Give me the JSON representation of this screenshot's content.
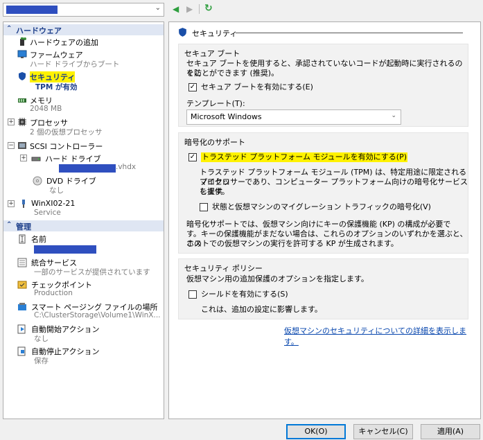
{
  "vm_selector": {
    "value": "",
    "chevron": "⌄"
  },
  "toolbar": {
    "back": "◀",
    "forward": "▶",
    "refresh": "↻"
  },
  "tree": {
    "hardware_header": "ハードウェア",
    "add_hardware": "ハードウェアの追加",
    "firmware": {
      "name": "ファームウェア",
      "sub": "ハード ドライブからブート"
    },
    "security": {
      "name": "セキュリティ",
      "sub": "TPM が有効"
    },
    "memory": {
      "name": "メモリ",
      "sub": "2048 MB"
    },
    "processor": {
      "name": "プロセッサ",
      "sub": "2 個の仮想プロセッサ"
    },
    "scsi": {
      "name": "SCSI コントローラー"
    },
    "hard_drive": {
      "name": "ハード ドライブ",
      "sub_suffix": ".vhdx"
    },
    "dvd": {
      "name": "DVD ドライブ",
      "sub": "なし"
    },
    "nic": {
      "name": "WinXI02-21",
      "sub": "Service"
    },
    "management_header": "管理",
    "name_item": {
      "name": "名前"
    },
    "integration": {
      "name": "統合サービス",
      "sub": "一部のサービスが提供されています"
    },
    "checkpoint": {
      "name": "チェックポイント",
      "sub": "Production"
    },
    "paging": {
      "name": "スマート ページング ファイルの場所",
      "sub": "C:\\ClusterStorage\\Volume1\\WinX..."
    },
    "autostart": {
      "name": "自動開始アクション",
      "sub": "なし"
    },
    "autostop": {
      "name": "自動停止アクション",
      "sub": "保存"
    }
  },
  "security_pane": {
    "title": "セキュリティ",
    "secure_boot": {
      "title": "セキュア ブート",
      "desc1": "セキュア ブートを使用すると、承認されていないコードが起動時に実行されるのを防",
      "desc2": "ぐことができます (推奨)。",
      "checkbox": "セキュア ブートを有効にする(E)",
      "checked": true,
      "template_label": "テンプレート(T):",
      "template_value": "Microsoft Windows"
    },
    "encryption": {
      "title": "暗号化のサポート",
      "tpm_checkbox": "トラステッド プラットフォーム モジュールを有効にする(P)",
      "tpm_checked": true,
      "tpm_desc1": "トラステッド プラットフォーム モジュール (TPM) は、特定用途に限定されるマイクロ",
      "tpm_desc2": "プロセッサーであり、コンピューター プラットフォーム向けの暗号化サービスを提供",
      "tpm_desc3": "します。",
      "migration_checkbox": "状態と仮想マシンのマイグレーション トラフィックの暗号化(V)",
      "migration_checked": false,
      "note1": "暗号化サポートでは、仮想マシン向けにキーの保護機能 (KP) の構成が必要で",
      "note2": "す。キーの保護機能がまだない場合は、これらのオプションのいずれかを選ぶと、この",
      "note3": "ホストでの仮想マシンの実行を許可する KP が生成されます。"
    },
    "policy": {
      "title": "セキュリティ ポリシー",
      "desc": "仮想マシン用の追加保護のオプションを指定します。",
      "shield_checkbox": "シールドを有効にする(S)",
      "shield_checked": false,
      "shield_desc": "これは、追加の設定に影響します。"
    },
    "more_link": "仮想マシンのセキュリティについての詳細を表示します。"
  },
  "buttons": {
    "ok": "OK(O)",
    "cancel": "キャンセル(C)",
    "apply": "適用(A)"
  },
  "colors": {
    "accent": "#1c3e8a",
    "highlight": "#fff200",
    "redaction": "#2f4fbf",
    "link": "#0645ad"
  }
}
